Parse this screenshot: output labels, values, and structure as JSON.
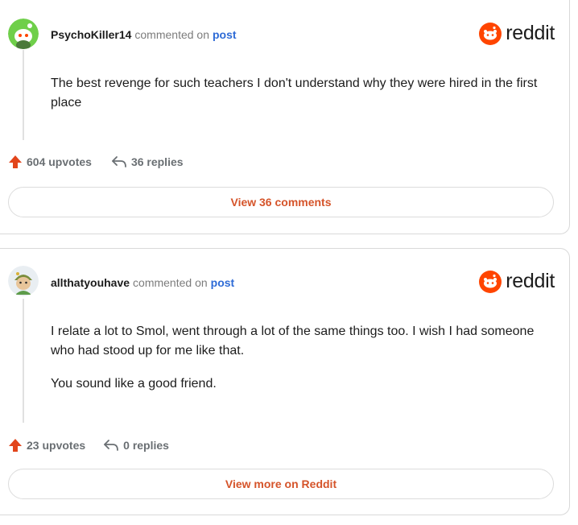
{
  "comments": [
    {
      "username": "PsychoKiller14",
      "commented_text": "commented on",
      "post_link": "post",
      "brand": "reddit",
      "body": [
        "The best revenge for such teachers I don't understand why they were hired in the first place"
      ],
      "upvotes": "604 upvotes",
      "replies": "36 replies",
      "button": "View 36 comments",
      "avatar_color": "#6fcf4a"
    },
    {
      "username": "allthatyouhave",
      "commented_text": "commented on",
      "post_link": "post",
      "brand": "reddit",
      "body": [
        "I relate a lot to Smol, went through a lot of the same things too. I wish I had someone who had stood up for me like that.",
        "You sound like a good friend."
      ],
      "upvotes": "23 upvotes",
      "replies": "0 replies",
      "button": "View more on Reddit",
      "avatar_color": "#e9eef2"
    }
  ],
  "colors": {
    "accent": "#d5542a",
    "upvote": "#e2451b",
    "reddit_orange": "#ff4500",
    "link_blue": "#2e6bd6"
  },
  "icons": {
    "brand": "reddit-logo-icon",
    "upvote": "upvote-arrow-icon",
    "reply": "reply-arrow-icon"
  }
}
